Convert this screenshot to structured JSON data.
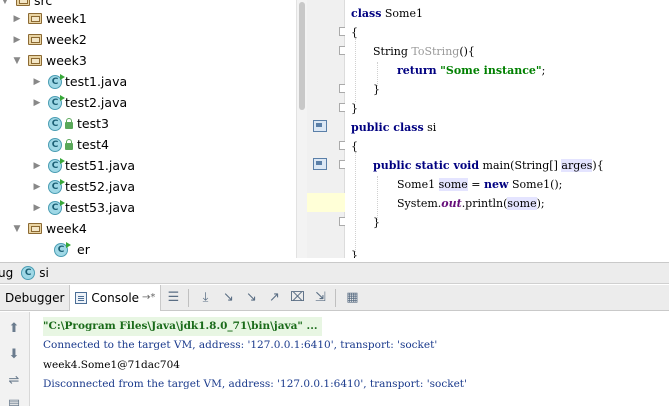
{
  "project_tree": {
    "items": [
      {
        "label": "src",
        "type": "folder",
        "arrow": "down",
        "indent": 0
      },
      {
        "label": "week1",
        "type": "folder",
        "arrow": "right",
        "indent": 1
      },
      {
        "label": "week2",
        "type": "folder",
        "arrow": "right",
        "indent": 1
      },
      {
        "label": "week3",
        "type": "folder",
        "arrow": "down",
        "indent": 1
      },
      {
        "label": "test1.java",
        "type": "java",
        "arrow": "right",
        "indent": 2
      },
      {
        "label": "test2.java",
        "type": "java",
        "arrow": "right",
        "indent": 2
      },
      {
        "label": "test3",
        "type": "class",
        "arrow": "",
        "indent": 2
      },
      {
        "label": "test4",
        "type": "class",
        "arrow": "",
        "indent": 2
      },
      {
        "label": "test51.java",
        "type": "java",
        "arrow": "right",
        "indent": 2
      },
      {
        "label": "test52.java",
        "type": "java",
        "arrow": "right",
        "indent": 2
      },
      {
        "label": "test53.java",
        "type": "java",
        "arrow": "right",
        "indent": 2
      },
      {
        "label": "week4",
        "type": "folder",
        "arrow": "down",
        "indent": 1
      },
      {
        "label": "er",
        "type": "class",
        "arrow": "",
        "indent": 2
      }
    ]
  },
  "editor": {
    "lines": [
      {
        "k": "class",
        "rest": " Some1"
      },
      {
        "text": "{"
      },
      {
        "type": "String",
        "gray": "ToString",
        "rest": "(){"
      },
      {
        "k": "return",
        "str": "\"Some instance\"",
        "rest": ";"
      },
      {
        "text": "}"
      },
      {
        "text": "}"
      },
      {
        "k": "public class",
        "rest": " si"
      },
      {
        "text": "{"
      },
      {
        "k": "public static void",
        "rest": " main(String[] ",
        "hl": "arges",
        "tail": "){"
      },
      {
        "pre": "Some1 ",
        "hl": "some",
        "mid": " = ",
        "k": "new",
        "rest": " Some1();"
      },
      {
        "pre": "System.",
        "fld": "out",
        "mid": ".println(",
        "hl": "some",
        "tail": ");"
      },
      {
        "text": "}"
      },
      {
        "text": "}"
      }
    ]
  },
  "debug": {
    "title_prefix": "ug",
    "run_config": "si",
    "tabs": {
      "debugger": "Debugger",
      "console": "Console",
      "pin": "→*"
    }
  },
  "console": {
    "lines": [
      {
        "text": "\"C:\\Program Files\\Java\\jdk1.8.0_71\\bin\\java\" ...",
        "kind": "cmd"
      },
      {
        "text": "Connected to the target VM, address: '127.0.0.1:6410', transport: 'socket'",
        "kind": "sys"
      },
      {
        "text": "week4.Some1@71dac704",
        "kind": "out"
      },
      {
        "text": "Disconnected from the target VM, address: '127.0.0.1:6410', transport: 'socket'",
        "kind": "sys"
      }
    ]
  },
  "colors": {
    "keyword": "#000080",
    "string": "#008000",
    "highlight_line": "#ffffd7",
    "console_cmd_bg": "#e8f6e3"
  }
}
